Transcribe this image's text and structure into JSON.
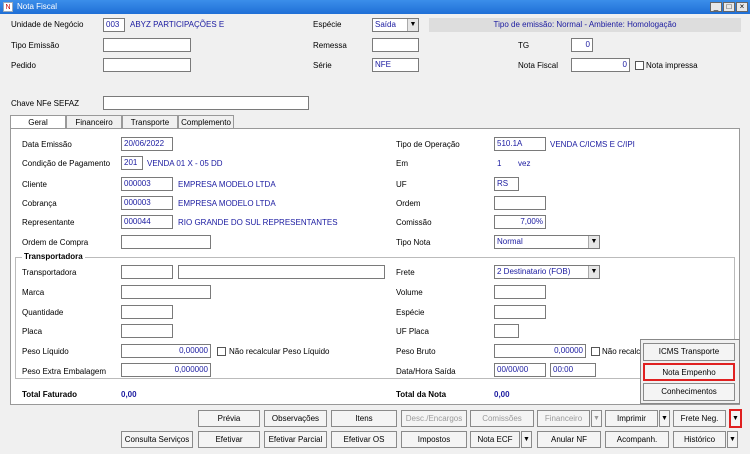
{
  "window": {
    "title": "Nota Fiscal",
    "icon": "app-icon"
  },
  "header": {
    "unidade_label": "Unidade de Negócio",
    "unidade_code": "003",
    "unidade_name": "ABYZ PARTICIPAÇÕES E",
    "especie_label": "Espécie",
    "especie_value": "Saída",
    "tipo_emissao_info": "Tipo de emissão: Normal - Ambiente: Homologação",
    "tipo_emissao_label": "Tipo Emissão",
    "remessa_label": "Remessa",
    "tg_label": "TG",
    "tg_value": "0",
    "pedido_label": "Pedido",
    "serie_label": "Série",
    "serie_value": "NFE",
    "nota_fiscal_label": "Nota Fiscal",
    "nota_fiscal_value": "0",
    "nota_impressa_label": "Nota impressa",
    "chave_label": "Chave NFe SEFAZ"
  },
  "tabs": [
    "Geral",
    "Financeiro",
    "Transporte",
    "Complemento"
  ],
  "geral": {
    "data_emissao_label": "Data Emissão",
    "data_emissao": "20/06/2022",
    "tipo_operacao_label": "Tipo de Operação",
    "tipo_operacao_code": "510.1A",
    "tipo_operacao_desc": "VENDA C/ICMS E C/IPI",
    "cond_pag_label": "Condição de Pagamento",
    "cond_pag_code": "201",
    "cond_pag_desc": "VENDA 01 X - 05 DD",
    "em_label": "Em",
    "em_value": "1",
    "em_unit": "vez",
    "cliente_label": "Cliente",
    "cliente_code": "000003",
    "cliente_name": "EMPRESA MODELO LTDA",
    "uf_label": "UF",
    "uf_value": "RS",
    "cobranca_label": "Cobrança",
    "cobranca_code": "000003",
    "cobranca_name": "EMPRESA MODELO LTDA",
    "ordem_label": "Ordem",
    "representante_label": "Representante",
    "representante_code": "000044",
    "representante_name": "RIO GRANDE DO SUL REPRESENTANTES",
    "comissao_label": "Comissão",
    "comissao_value": "7,00%",
    "ordem_compra_label": "Ordem de Compra",
    "tipo_nota_label": "Tipo Nota",
    "tipo_nota_value": "Normal"
  },
  "transportadora": {
    "group_label": "Transportadora",
    "transportadora_label": "Transportadora",
    "frete_label": "Frete",
    "frete_value": "2 Destinatario (FOB)",
    "marca_label": "Marca",
    "volume_label": "Volume",
    "quantidade_label": "Quantidade",
    "especie_label": "Espécie",
    "placa_label": "Placa",
    "uf_placa_label": "UF Placa",
    "peso_liquido_label": "Peso Líquido",
    "peso_liquido": "0,00000",
    "nao_recalc_liquido": "Não recalcular Peso Líquido",
    "peso_bruto_label": "Peso Bruto",
    "peso_bruto": "0,00000",
    "nao_recalc_bruto": "Não recalcu",
    "peso_extra_label": "Peso Extra Embalagem",
    "peso_extra": "0,000000",
    "data_hora_saida_label": "Data/Hora Saída",
    "data_saida": "00/00/00",
    "hora_saida": "00:00"
  },
  "totals": {
    "total_faturado_label": "Total Faturado",
    "total_faturado": "0,00",
    "total_nota_label": "Total da Nota",
    "total_nota": "0,00"
  },
  "buttons_row1": [
    "Prévia",
    "Observações",
    "Itens",
    "Desc./Encargos",
    "Comissões",
    "Financeiro",
    "Imprimir",
    "Frete Neg."
  ],
  "buttons_row2": [
    "Consulta Serviços",
    "Efetivar",
    "Efetivar Parcial",
    "Efetivar OS",
    "Impostos",
    "Nota ECF",
    "Anular NF",
    "Acompanh.",
    "Histórico"
  ],
  "popup_menu": [
    "ICMS Transporte",
    "Nota Empenho",
    "Conhecimentos"
  ],
  "colors": {
    "highlight": "#e02020",
    "field_text": "#1a1aa0",
    "titlebar": "#1f6fd6"
  }
}
